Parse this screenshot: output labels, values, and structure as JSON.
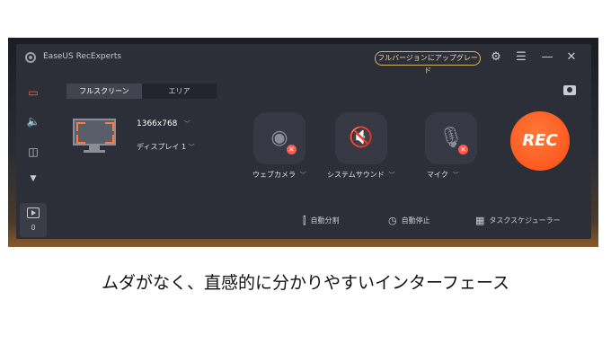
{
  "app": {
    "title": "EaseUS RecExperts",
    "upgrade_label": "フルバージョンにアップグレード"
  },
  "titlebar_icons": [
    "settings-icon",
    "menu-icon",
    "minimize-icon",
    "close-icon"
  ],
  "sidebar": {
    "items": [
      "screen-icon",
      "audio-icon",
      "game-icon",
      "more-icon"
    ],
    "recordings_count": "0"
  },
  "tabs": [
    {
      "label": "フルスクリーン",
      "active": true
    },
    {
      "label": "エリア",
      "active": false
    }
  ],
  "display": {
    "resolution": "1366x768",
    "name": "ディスプレイ 1"
  },
  "devices": [
    {
      "label": "ウェブカメラ",
      "icon": "webcam-icon"
    },
    {
      "label": "システムサウンド",
      "icon": "speaker-muted-icon"
    },
    {
      "label": "マイク",
      "icon": "microphone-icon"
    }
  ],
  "rec_label": "REC",
  "bottom_tools": [
    {
      "label": "自動分割",
      "icon": "split-icon"
    },
    {
      "label": "自動停止",
      "icon": "clock-icon"
    },
    {
      "label": "タスクスケジューラー",
      "icon": "calendar-icon"
    }
  ],
  "caption": "ムダがなく、直感的に分かりやすいインターフェース",
  "colors": {
    "accent": "#ff5a1f",
    "upgrade_border": "#d7b46a",
    "window_bg": "#2c2f38"
  }
}
